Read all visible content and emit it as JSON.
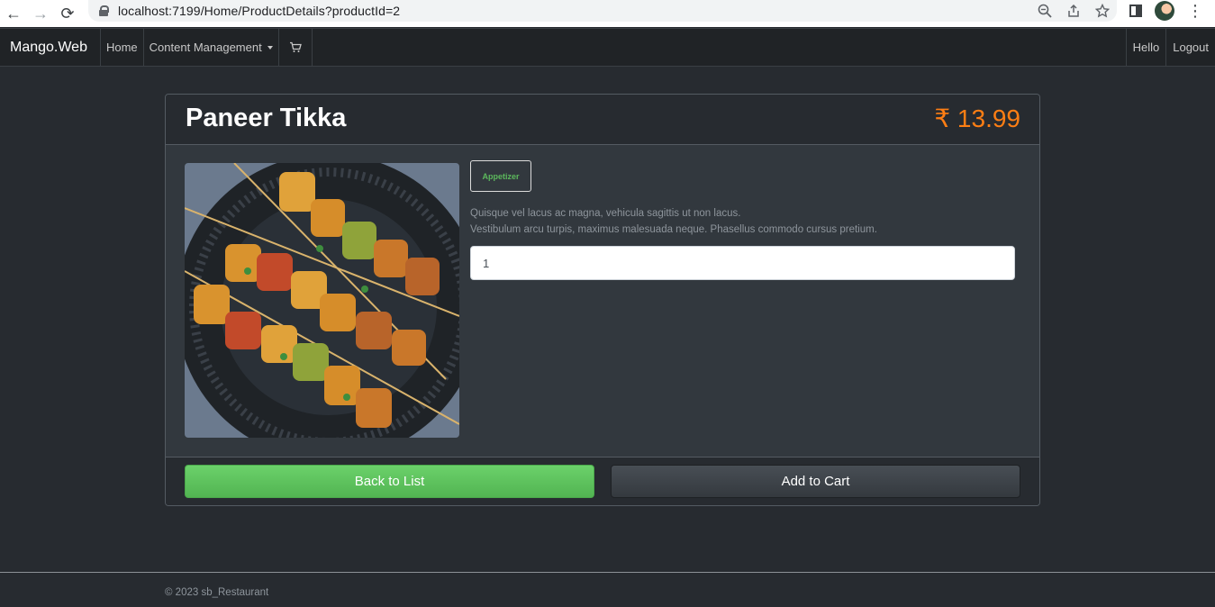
{
  "browser": {
    "back_icon": "arrow-left-icon",
    "forward_icon": "arrow-right-icon",
    "reload_icon": "reload-icon",
    "url": "localhost:7199/Home/ProductDetails?productId=2"
  },
  "navbar": {
    "brand": "Mango.Web",
    "links": {
      "home": "Home",
      "content_management": "Content Management"
    },
    "cart_icon": "cart-icon",
    "hello": "Hello",
    "logout": "Logout"
  },
  "product": {
    "name": "Paneer Tikka",
    "price": "₹ 13.99",
    "category": "Appetizer",
    "description_line1": "Quisque vel lacus ac magna, vehicula sagittis ut non lacus.",
    "description_line2": "Vestibulum arcu turpis, maximus malesuada neque. Phasellus commodo cursus pretium.",
    "quantity": "1"
  },
  "actions": {
    "back_to_list": "Back to List",
    "add_to_cart": "Add to Cart"
  },
  "footer": {
    "copyright": "© 2023 sb_Restaurant"
  },
  "colors": {
    "price": "#fd7e14",
    "badge_text": "#5cb85c",
    "back_button": "#5cb85c",
    "background": "#272b30",
    "card": "#32383e"
  }
}
